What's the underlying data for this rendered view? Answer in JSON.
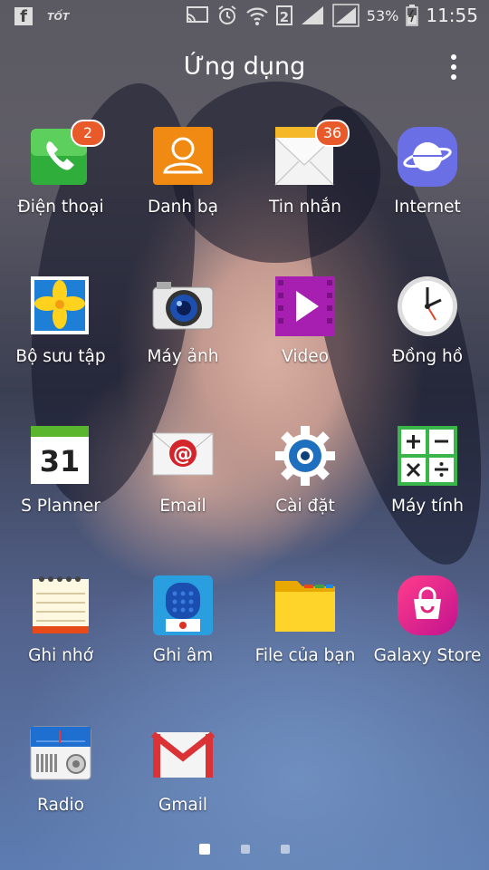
{
  "status_bar": {
    "left_icons": [
      "facebook-icon",
      "tot-icon"
    ],
    "tot_text": "TỐT",
    "sim_number": "2",
    "battery_percent": "53%",
    "time": "11:55"
  },
  "header": {
    "title": "Ứng dụng"
  },
  "apps": [
    {
      "label": "Điện thoại",
      "icon": "phone-icon",
      "badge": "2"
    },
    {
      "label": "Danh bạ",
      "icon": "contacts-icon"
    },
    {
      "label": "Tin nhắn",
      "icon": "messages-icon",
      "badge": "36"
    },
    {
      "label": "Internet",
      "icon": "internet-icon"
    },
    {
      "label": "Bộ sưu tập",
      "icon": "gallery-icon"
    },
    {
      "label": "Máy ảnh",
      "icon": "camera-icon"
    },
    {
      "label": "Video",
      "icon": "video-icon"
    },
    {
      "label": "Đồng hồ",
      "icon": "clock-icon"
    },
    {
      "label": "S Planner",
      "icon": "calendar-icon",
      "date": "31"
    },
    {
      "label": "Email",
      "icon": "email-icon"
    },
    {
      "label": "Cài đặt",
      "icon": "settings-icon"
    },
    {
      "label": "Máy tính",
      "icon": "calculator-icon"
    },
    {
      "label": "Ghi nhớ",
      "icon": "memo-icon"
    },
    {
      "label": "Ghi âm",
      "icon": "voice-recorder-icon"
    },
    {
      "label": "File của bạn",
      "icon": "folder-icon"
    },
    {
      "label": "Galaxy Store",
      "icon": "store-icon"
    },
    {
      "label": "Radio",
      "icon": "radio-icon"
    },
    {
      "label": "Gmail",
      "icon": "gmail-icon"
    }
  ],
  "pager": {
    "pages": 3,
    "active": 1
  }
}
